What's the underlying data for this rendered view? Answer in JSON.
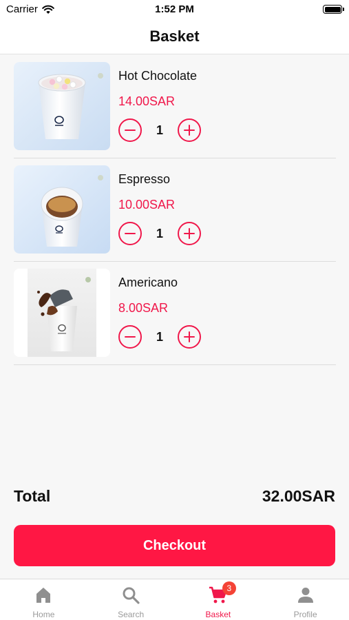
{
  "status_bar": {
    "carrier": "Carrier",
    "time": "1:52 PM"
  },
  "header": {
    "title": "Basket"
  },
  "items": [
    {
      "name": "Hot Chocolate",
      "price": "14.00SAR",
      "quantity": "1",
      "image": "hot-chocolate-cup"
    },
    {
      "name": "Espresso",
      "price": "10.00SAR",
      "quantity": "1",
      "image": "espresso-cup"
    },
    {
      "name": "Americano",
      "price": "8.00SAR",
      "quantity": "1",
      "image": "americano-cup"
    }
  ],
  "summary": {
    "total_label": "Total",
    "total_value": "32.00SAR"
  },
  "checkout": {
    "label": "Checkout"
  },
  "tabs": [
    {
      "label": "Home",
      "icon": "home-icon",
      "active": false
    },
    {
      "label": "Search",
      "icon": "search-icon",
      "active": false
    },
    {
      "label": "Basket",
      "icon": "cart-icon",
      "active": true,
      "badge": "3"
    },
    {
      "label": "Profile",
      "icon": "person-icon",
      "active": false
    }
  ],
  "colors": {
    "accent": "#f0174a",
    "checkout": "#ff1744",
    "badge": "#f44336",
    "inactive": "#9a9a9a"
  }
}
